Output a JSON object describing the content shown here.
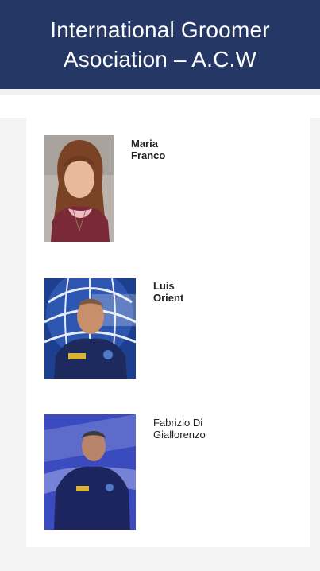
{
  "header": {
    "title_line1": "International Groomer",
    "title_line2": "Asociation – A.C.W",
    "background_color": "#253764"
  },
  "members": [
    {
      "name": "Maria Franco",
      "photo_icon": "portrait-woman"
    },
    {
      "name": "Luis Orient",
      "photo_icon": "portrait-man-globe-backdrop"
    },
    {
      "name": "Fabrizio Di Giallorenzo",
      "photo_icon": "portrait-man-blue-backdrop"
    }
  ]
}
